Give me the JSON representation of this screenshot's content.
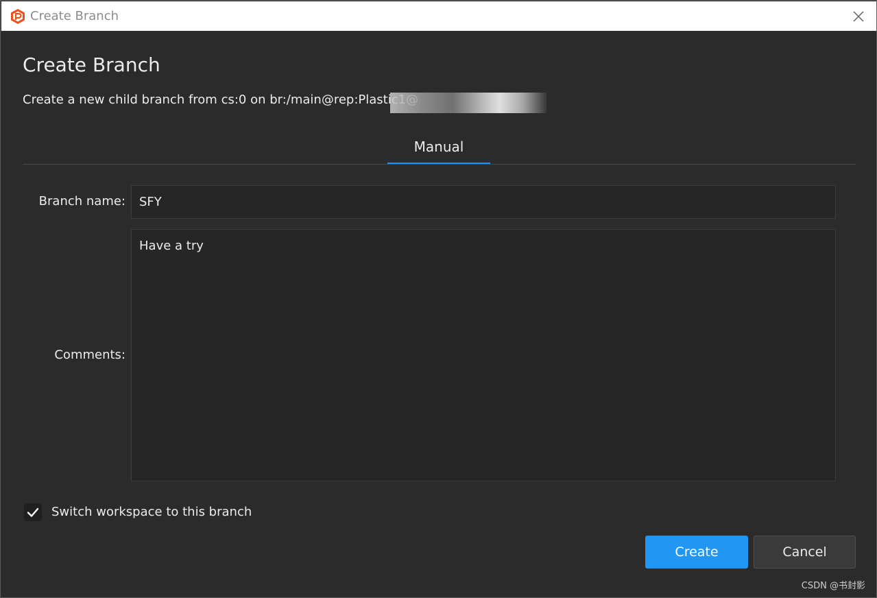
{
  "window": {
    "title": "Create Branch",
    "close_icon": "close-icon"
  },
  "dialog": {
    "heading": "Create Branch",
    "subtitle": "Create a new child branch from cs:0 on br:/main@rep:Plastic1@",
    "subtitle_suffix_redacted": true
  },
  "tabs": [
    {
      "label": "Manual",
      "active": true
    }
  ],
  "form": {
    "branch_name_label": "Branch name:",
    "branch_name_value": "SFY",
    "comments_label": "Comments:",
    "comments_value": "Have a try",
    "switch_workspace_label": "Switch workspace to this branch",
    "switch_workspace_checked": true
  },
  "actions": {
    "create_label": "Create",
    "cancel_label": "Cancel"
  },
  "watermark": "CSDN @书封影",
  "colors": {
    "accent": "#2196f3",
    "background": "#2b2b2b",
    "app_icon": "#e8531e"
  }
}
